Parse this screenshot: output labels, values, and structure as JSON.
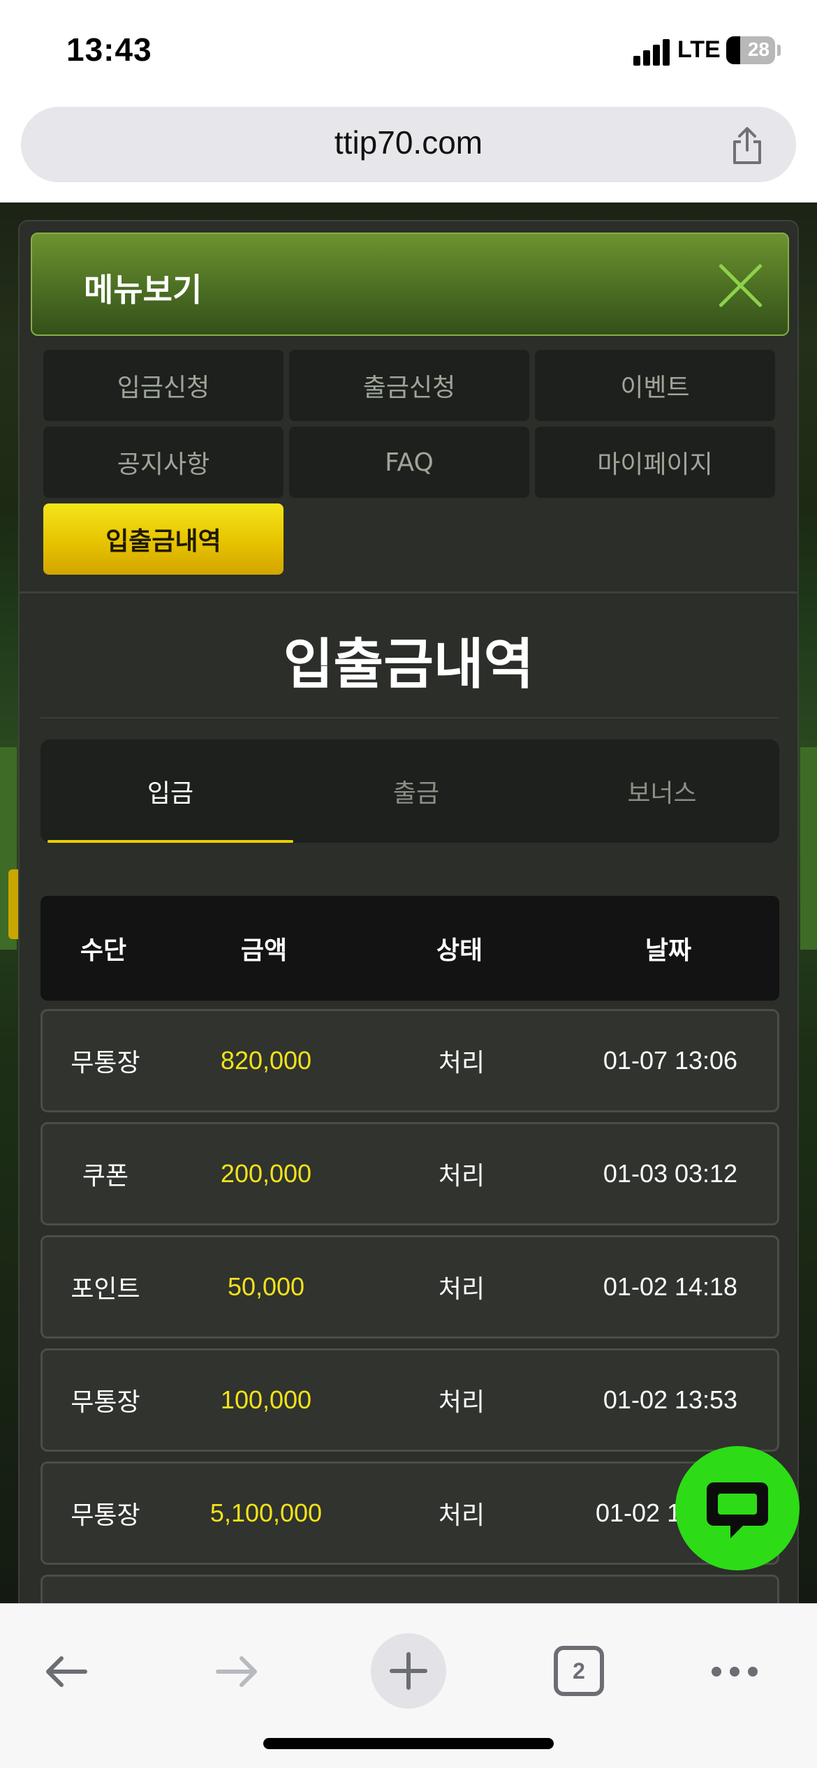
{
  "status_bar": {
    "time": "13:43",
    "network": "LTE",
    "battery": "28",
    "battery_level": 0.28
  },
  "browser": {
    "url": "ttip70.com",
    "tab_count": "2"
  },
  "modal": {
    "title": "메뉴보기",
    "menu": [
      {
        "label": "입금신청",
        "active": false
      },
      {
        "label": "출금신청",
        "active": false
      },
      {
        "label": "이벤트",
        "active": false
      },
      {
        "label": "공지사항",
        "active": false
      },
      {
        "label": "FAQ",
        "active": false
      },
      {
        "label": "마이페이지",
        "active": false
      },
      {
        "label": "입출금내역",
        "active": true
      }
    ],
    "section_title": "입출금내역",
    "tabs": [
      {
        "label": "입금",
        "active": true
      },
      {
        "label": "출금",
        "active": false
      },
      {
        "label": "보너스",
        "active": false
      }
    ],
    "table": {
      "headers": [
        "수단",
        "금액",
        "상태",
        "날짜"
      ],
      "rows": [
        {
          "method": "무통장",
          "amount": "820,000",
          "status": "처리",
          "date": "01-07 13:06"
        },
        {
          "method": "쿠폰",
          "amount": "200,000",
          "status": "처리",
          "date": "01-03 03:12"
        },
        {
          "method": "포인트",
          "amount": "50,000",
          "status": "처리",
          "date": "01-02 14:18"
        },
        {
          "method": "무통장",
          "amount": "100,000",
          "status": "처리",
          "date": "01-02 13:53"
        },
        {
          "method": "무통장",
          "amount": "5,100,000",
          "status": "처리",
          "date": "01-02 13:"
        }
      ]
    }
  },
  "colors": {
    "accent_yellow": "#f2e21b",
    "header_green": "#4b6e22",
    "chat_green": "#2ddc16"
  },
  "icons": [
    "share-icon",
    "close-icon",
    "chat-icon",
    "back-arrow-icon",
    "forward-arrow-icon",
    "new-tab-plus-icon",
    "tabs-icon",
    "more-icon"
  ]
}
